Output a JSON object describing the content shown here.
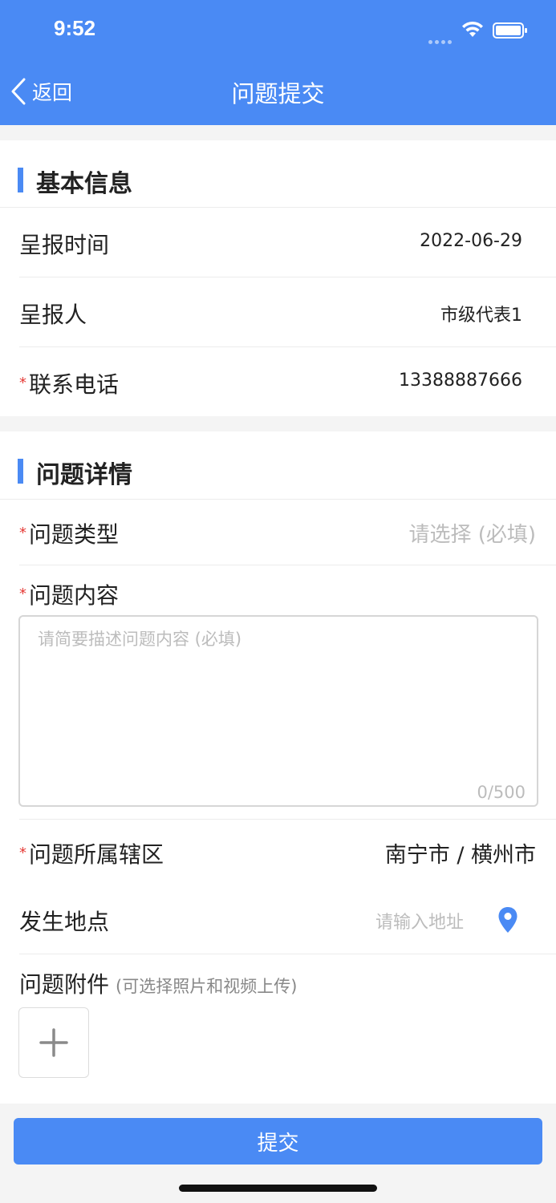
{
  "status_bar": {
    "time": "9:52"
  },
  "nav": {
    "back_label": "返回",
    "title": "问题提交"
  },
  "basic_info": {
    "title": "基本信息",
    "report_time": {
      "label": "呈报时间",
      "value": "2022-06-29"
    },
    "reporter": {
      "label": "呈报人",
      "value": "市级代表1"
    },
    "phone": {
      "label": "联系电话",
      "value": "13388887666",
      "required": "*"
    }
  },
  "detail": {
    "title": "问题详情",
    "type": {
      "label": "问题类型",
      "placeholder": "请选择 (必填)",
      "required": "*"
    },
    "content": {
      "label": "问题内容",
      "placeholder": "请简要描述问题内容 (必填)",
      "counter": "0/500",
      "required": "*"
    },
    "district": {
      "label": "问题所属辖区",
      "value": "南宁市 / 横州市",
      "required": "*"
    },
    "location": {
      "label": "发生地点",
      "placeholder": "请输入地址"
    },
    "attachment": {
      "label": "问题附件",
      "hint": "(可选择照片和视频上传)"
    }
  },
  "icons": {
    "back": "chevron-left-icon",
    "wifi": "wifi-icon",
    "battery": "battery-icon",
    "location": "location-pin-icon",
    "add": "plus-icon"
  },
  "colors": {
    "primary": "#4a8af4",
    "required": "#e53935",
    "placeholder": "#bcbcbc"
  },
  "submit": {
    "label": "提交"
  }
}
